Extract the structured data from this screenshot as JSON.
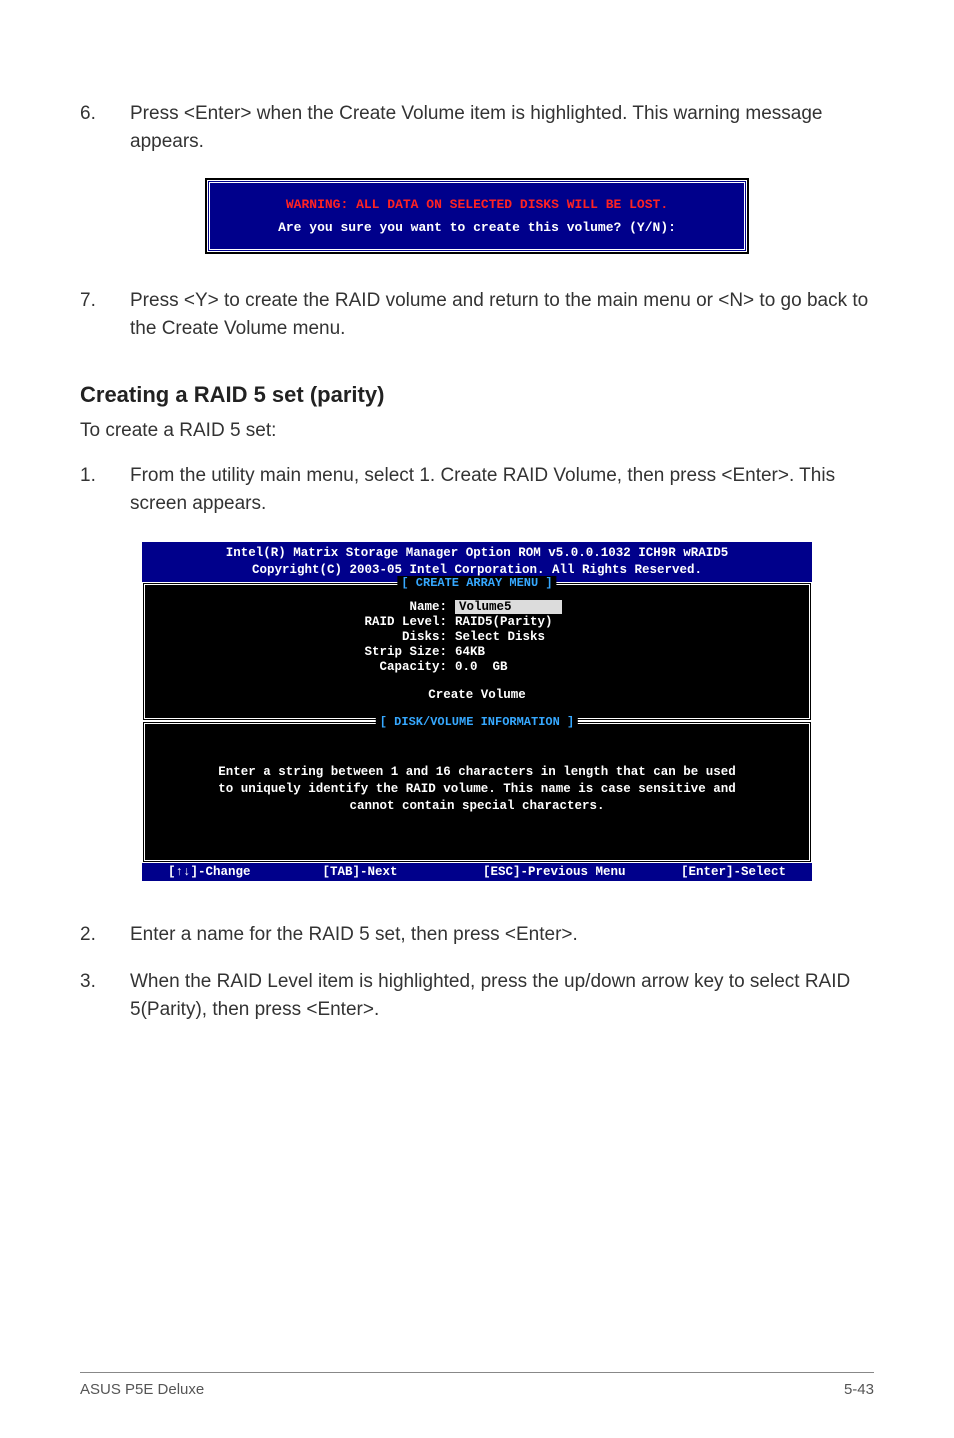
{
  "step6": {
    "num": "6.",
    "text": "Press <Enter> when the Create Volume item is highlighted. This warning message appears."
  },
  "warnbox": {
    "line1": "WARNING: ALL DATA ON SELECTED DISKS WILL BE LOST.",
    "line2": "Are you sure you want to create this volume? (Y/N):"
  },
  "step7": {
    "num": "7.",
    "text": "Press <Y> to create the RAID volume and return to the main menu or <N> to go back to the Create Volume menu."
  },
  "heading": "Creating a RAID 5 set (parity)",
  "lead": "To create a RAID 5 set:",
  "step1": {
    "num": "1.",
    "text": "From the utility main menu, select 1. Create RAID Volume, then press <Enter>. This screen appears."
  },
  "bios": {
    "header1": "Intel(R) Matrix Storage Manager Option ROM v5.0.0.1032 ICH9R wRAID5",
    "header2": "Copyright(C) 2003-05 Intel Corporation. All Rights Reserved.",
    "box1_title": "[ CREATE ARRAY MENU ]",
    "rows": {
      "name_label": "Name:",
      "name_val": "Volume5",
      "raid_label": "RAID Level:",
      "raid_val": "RAID5(Parity)",
      "disks_label": "Disks:",
      "disks_val": "Select Disks",
      "strip_label": "Strip Size:",
      "strip_val": "64KB",
      "cap_label": "Capacity:",
      "cap_val": "0.0  GB"
    },
    "create": "Create Volume",
    "box2_title": "[ DISK/VOLUME INFORMATION ]",
    "help1": "Enter a string between 1 and 16 characters in length that can be used",
    "help2": "to uniquely identify the RAID volume. This name is case sensitive and",
    "help3": "cannot contain special characters.",
    "footer": {
      "a": "[↑↓]-Change",
      "b": "[TAB]-Next",
      "c": "[ESC]-Previous Menu",
      "d": "[Enter]-Select"
    }
  },
  "step2": {
    "num": "2.",
    "text": "Enter a name for the RAID 5 set, then press <Enter>."
  },
  "step3": {
    "num": "3.",
    "text": "When the RAID Level item is highlighted, press the up/down arrow key to select RAID 5(Parity), then press <Enter>."
  },
  "footer": {
    "left": "ASUS P5E Deluxe",
    "right": "5-43"
  }
}
